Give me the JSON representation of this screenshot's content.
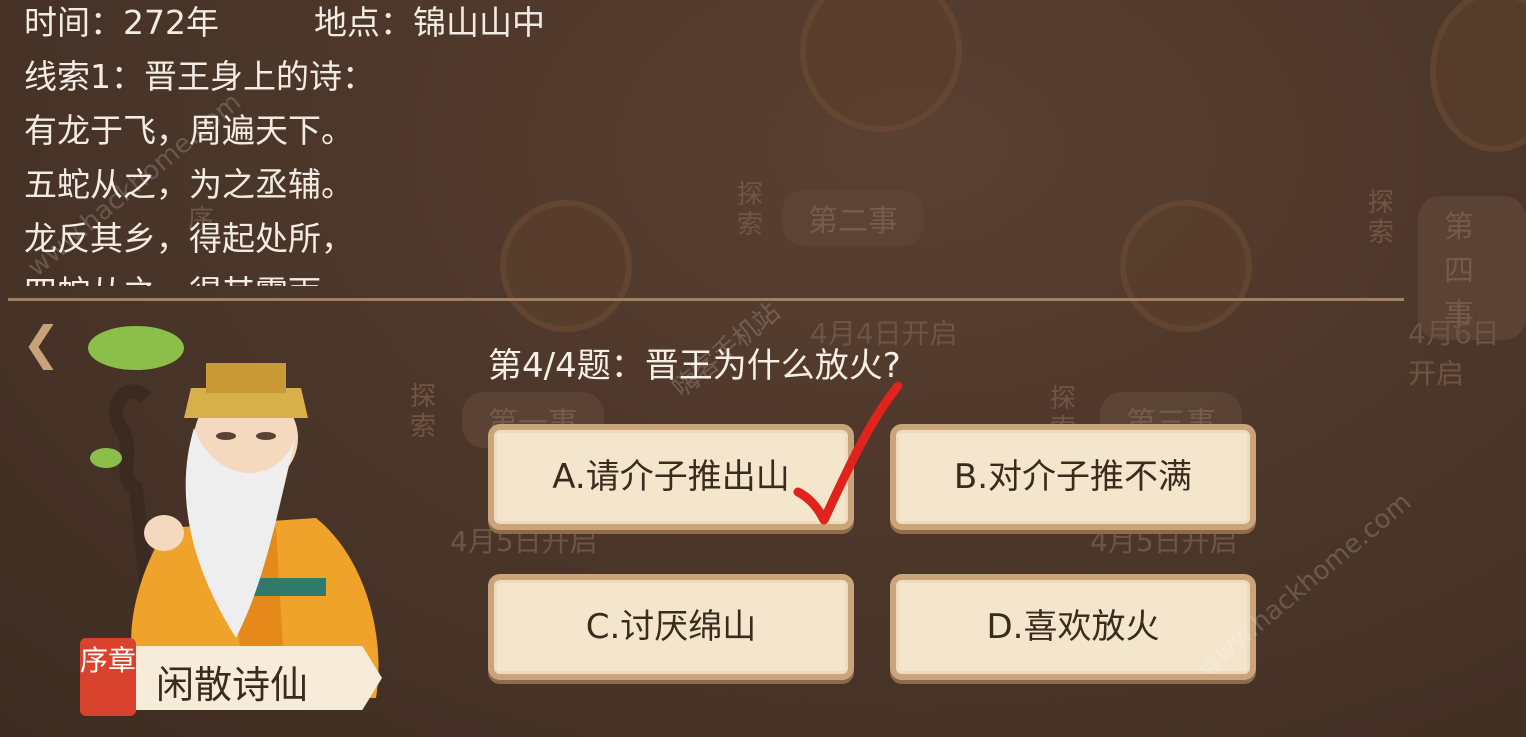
{
  "clue": {
    "time_label": "时间：272年",
    "place_label": "地点：锦山山中",
    "clue_title": "线索1：晋王身上的诗：",
    "poem_lines": [
      "有龙于飞，周遍天下。",
      "五蛇从之，为之丞辅。",
      "龙反其乡，得起处所，",
      "四蛇从之，得其露雨"
    ]
  },
  "background": {
    "chapters": [
      "第二事",
      "第一事",
      "第三事",
      "第四事"
    ],
    "explore_label": "探索",
    "prologue_char": "序",
    "dates": [
      "4月4日开启",
      "4月5日开启",
      "4月5日开启",
      "4月6日开启"
    ]
  },
  "question": {
    "text": "第4/4题：晋王为什么放火?"
  },
  "answers": [
    {
      "label": "A.请介子推出山",
      "correct": true
    },
    {
      "label": "B.对介子推不满",
      "correct": false
    },
    {
      "label": "C.讨厌绵山",
      "correct": false
    },
    {
      "label": "D.喜欢放火",
      "correct": false
    }
  ],
  "character": {
    "chapter_tag": "序章",
    "name": "闲散诗仙"
  },
  "watermarks": [
    "www.hackhome.com",
    "嗨客手机站",
    "www.hackhome.com"
  ],
  "colors": {
    "overlay_bg": "#4a3529",
    "answer_bg": "#f4e6cc",
    "check_mark": "#e0231c",
    "chapter_tag": "#d9432e"
  }
}
